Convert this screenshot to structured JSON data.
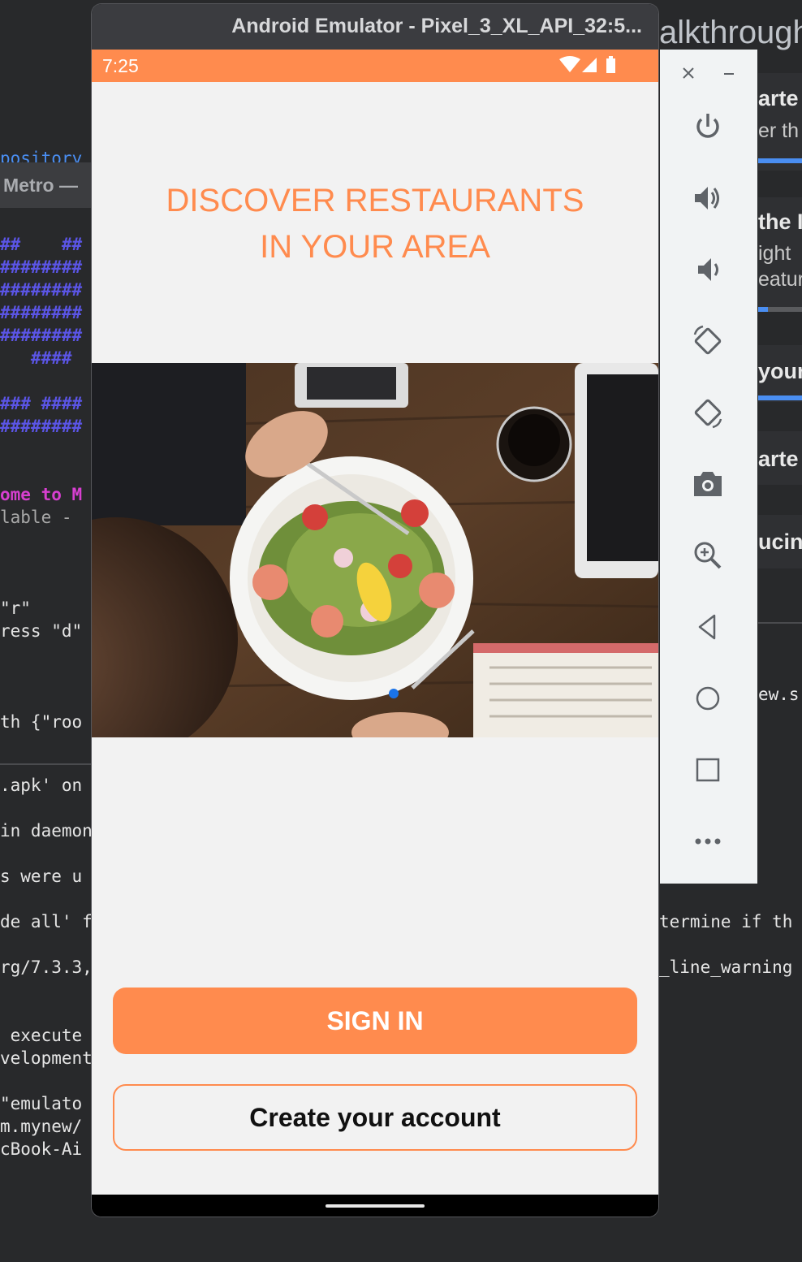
{
  "emulator": {
    "title": "Android Emulator - Pixel_3_XL_API_32:5...",
    "status_time": "7:25"
  },
  "app": {
    "headline_line1": "DISCOVER RESTAURANTS",
    "headline_line2": "IN YOUR AREA",
    "hero_image": "restaurant-salad-photo",
    "signin_label": "SIGN IN",
    "create_account_label": "Create your account",
    "accent_color": "#ff8b4e"
  },
  "toolbar": {
    "items": [
      "close-icon",
      "minimize-icon",
      "power-icon",
      "volume-up-icon",
      "volume-down-icon",
      "rotate-left-icon",
      "rotate-right-icon",
      "camera-icon",
      "zoom-icon",
      "back-icon",
      "home-icon",
      "overview-icon",
      "more-icon"
    ]
  },
  "background_left": {
    "metro_tab": "Metro —",
    "repo_fragment": "pository",
    "hash_rows": [
      "##    ##",
      "########",
      "########",
      "########",
      "########",
      "   ####",
      "",
      "### ####",
      "########"
    ],
    "welcome": "ome to M",
    "available": "lable -",
    "r_key": "\"r\"",
    "press_d": "ress \"d\"",
    "root": "th {\"roo",
    "apk": ".apk' on",
    "daemon": "in daemon",
    "were": "s were u",
    "de_all": "de all' f",
    "rg": "rg/7.3.3,",
    "executed": " execute",
    "development": "velopment",
    "emulator": "\"emulato",
    "mynew": "m.mynew/",
    "macbook": "cBook-Ai"
  },
  "background_right": {
    "walkthrough": "alkthrough",
    "started1": "arte",
    "under": "er th",
    "the": "the I",
    "right": "ight",
    "feature": "eatur",
    "your": "your",
    "started2": "arte",
    "introducing": "ucing",
    "view": "ew.s",
    "determine": "termine if th",
    "line_warning": "_line_warning"
  }
}
